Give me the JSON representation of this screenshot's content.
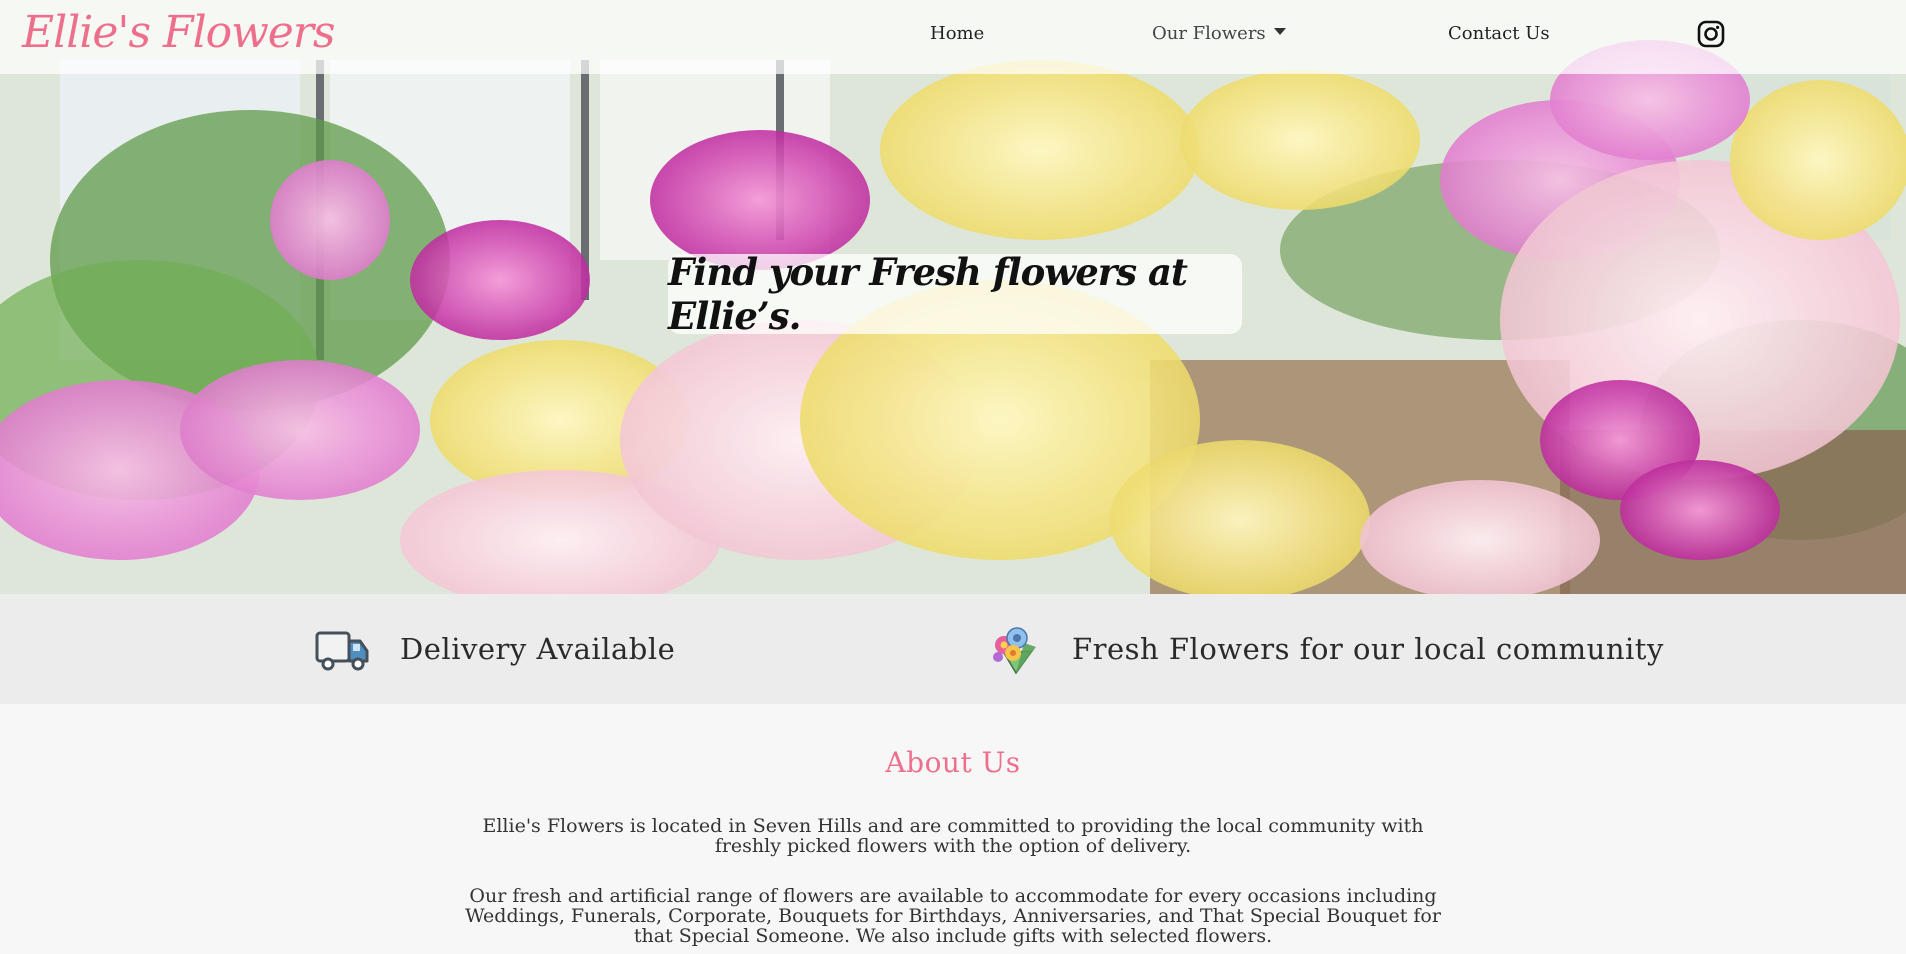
{
  "brand": "Ellie's Flowers",
  "nav": {
    "home": "Home",
    "our_flowers": "Our Flowers",
    "contact": "Contact Us",
    "social_icon": "instagram-icon"
  },
  "hero": {
    "caption": "Find your Fresh flowers at Ellie’s."
  },
  "features": {
    "delivery": {
      "icon": "delivery-truck-icon",
      "label": "Delivery Available"
    },
    "fresh": {
      "icon": "flower-bouquet-icon",
      "label": "Fresh Flowers for our local community"
    }
  },
  "about": {
    "title": "About Us",
    "paragraph1": "Ellie's Flowers is located in Seven Hills and are committed to providing the local community with freshly picked flowers with the option of delivery.",
    "paragraph2": "Our fresh and artificial range of flowers are available to accommodate for every occasions including Weddings, Funerals, Corporate, Bouquets for Birthdays, Anniversaries, and That Special Bouquet for that Special Someone. We also include gifts with selected flowers."
  },
  "colors": {
    "brand_pink": "#ee6f8c",
    "feature_bar": "#ececec",
    "page_bg": "#f7f7f7"
  }
}
